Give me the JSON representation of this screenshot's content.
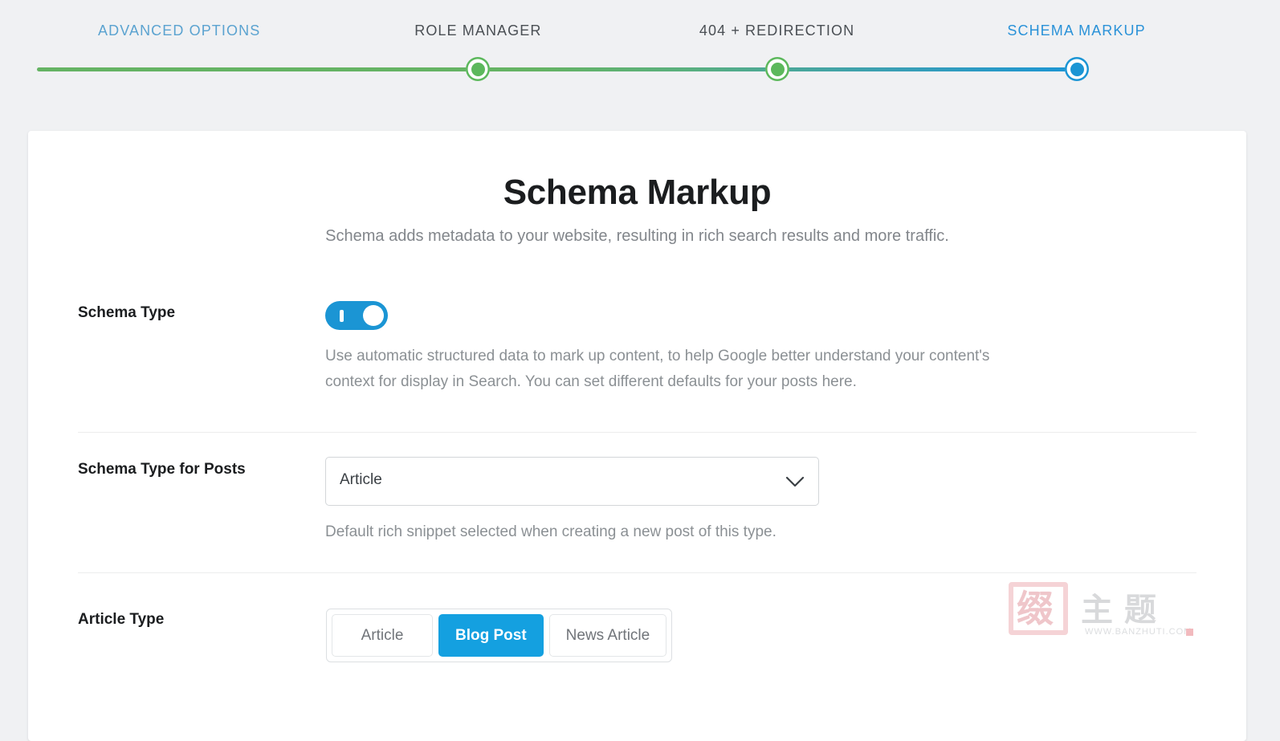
{
  "wizard": {
    "steps": [
      {
        "label": "ADVANCED OPTIONS",
        "state": "done",
        "x_pct": 14.0,
        "node": false
      },
      {
        "label": "ROLE MANAGER",
        "state": "plain",
        "x_pct": 37.35,
        "node": "green"
      },
      {
        "label": "404 + REDIRECTION",
        "state": "plain",
        "x_pct": 60.7,
        "node": "green"
      },
      {
        "label": "SCHEMA MARKUP",
        "state": "active",
        "x_pct": 84.1,
        "node": "blue"
      }
    ],
    "colors": {
      "done_label": "#5ba3d0",
      "plain_label": "#4a4f54",
      "active_label": "#2a92d8",
      "track_start": "#65b363",
      "track_end": "#1b95d4"
    }
  },
  "card": {
    "title": "Schema Markup",
    "subtitle": "Schema adds metadata to your website, resulting in rich search results and more traffic."
  },
  "rows": {
    "schema_type": {
      "label": "Schema Type",
      "toggle_state": "on",
      "toggle_color": "#1b95d4",
      "help_line1": "Use automatic structured data to mark up content, to help Google better understand your content's",
      "help_line2": "context for display in Search. You can set different defaults for your posts here."
    },
    "schema_type_for_posts": {
      "label": "Schema Type for Posts",
      "selected_value": "Article",
      "help": "Default rich snippet selected when creating a new post of this type."
    },
    "article_type": {
      "label": "Article Type",
      "options": [
        {
          "label": "Article",
          "selected": false
        },
        {
          "label": "Blog Post",
          "selected": true
        },
        {
          "label": "News Article",
          "selected": false
        }
      ],
      "selected_color": "#14a0e0"
    }
  },
  "watermark": {
    "seal_glyph": "缀",
    "cn_text": "主题",
    "url": "WWW.BANZHUTI.COM"
  }
}
